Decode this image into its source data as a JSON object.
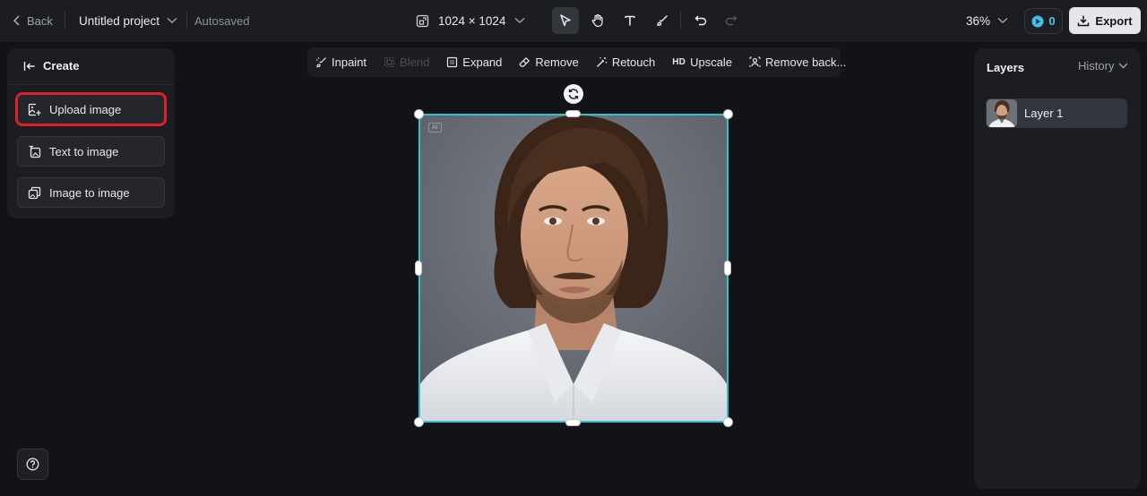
{
  "topbar": {
    "back_label": "Back",
    "project_title": "Untitled project",
    "autosave_status": "Autosaved",
    "canvas_size": "1024 × 1024",
    "zoom_level": "36%",
    "credits_count": "0",
    "export_label": "Export",
    "tools": [
      "select-tool",
      "hand-tool",
      "text-tool",
      "brush-tool",
      "undo",
      "redo"
    ]
  },
  "left_panel": {
    "header_label": "Create",
    "buttons": [
      {
        "label": "Upload image",
        "icon": "upload-image-icon"
      },
      {
        "label": "Text to image",
        "icon": "text-to-image-icon"
      },
      {
        "label": "Image to image",
        "icon": "image-to-image-icon"
      }
    ]
  },
  "context_toolbar": {
    "items": [
      {
        "label": "Inpaint",
        "enabled": true
      },
      {
        "label": "Blend",
        "enabled": false
      },
      {
        "label": "Expand",
        "enabled": true
      },
      {
        "label": "Remove",
        "enabled": true
      },
      {
        "label": "Retouch",
        "enabled": true
      },
      {
        "label": "Upscale",
        "prefix": "HD",
        "enabled": true
      },
      {
        "label": "Remove back...",
        "enabled": true
      }
    ]
  },
  "canvas": {
    "ai_badge": "AI",
    "selection_color": "#2bc4cf"
  },
  "right_panel": {
    "title": "Layers",
    "history_label": "History",
    "layers": [
      {
        "name": "Layer 1"
      }
    ]
  },
  "colors": {
    "background": "#121317",
    "panel": "#1c1d22",
    "accent_cyan": "#4fc7ea",
    "highlight_red": "#e0202a"
  }
}
